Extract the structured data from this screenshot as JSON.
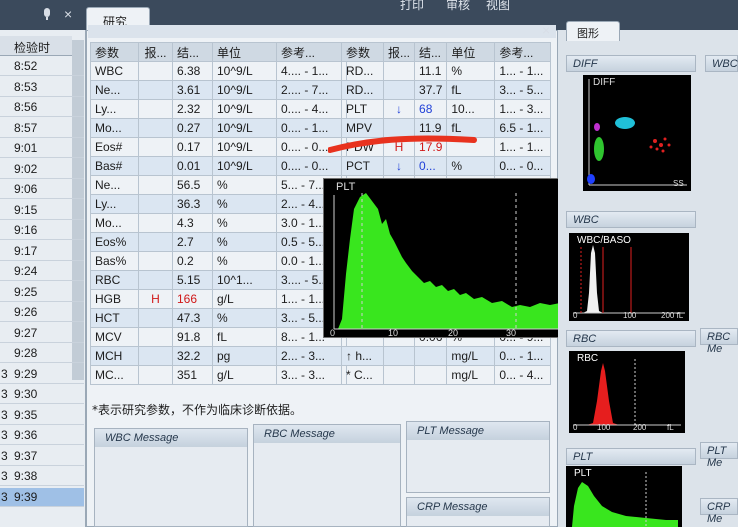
{
  "topbar": {
    "items": [
      "打印",
      "审核",
      "视图"
    ],
    "tab_research": "研究",
    "tab_graphics": "图形",
    "close": "×"
  },
  "left_panel": {
    "header": "检验时",
    "times": [
      "8:52",
      "8:53",
      "8:56",
      "8:57",
      "9:01",
      "9:02",
      "9:06",
      "9:15",
      "9:16",
      "9:17",
      "9:24",
      "9:25",
      "9:26",
      "9:27",
      "9:28",
      "9:29",
      "9:30",
      "9:35",
      "9:36",
      "9:37",
      "9:38",
      "9:39"
    ],
    "prefixes": [
      "",
      "",
      "",
      "",
      "",
      "",
      "",
      "",
      "",
      "",
      "",
      "",
      "",
      "",
      "",
      "3",
      "3",
      "3",
      "3",
      "3",
      "3",
      "3"
    ],
    "selected_index": 21
  },
  "table1": {
    "headers": [
      "参数",
      "报...",
      "结...",
      "单位",
      "参考..."
    ],
    "rows": [
      {
        "name": "WBC",
        "flag": "",
        "result": "6.38",
        "unit": "10^9/L",
        "ref": "4.... - 1..."
      },
      {
        "name": "Ne...",
        "flag": "",
        "result": "3.61",
        "unit": "10^9/L",
        "ref": "2.... - 7..."
      },
      {
        "name": "Ly...",
        "flag": "",
        "result": "2.32",
        "unit": "10^9/L",
        "ref": "0.... - 4..."
      },
      {
        "name": "Mo...",
        "flag": "",
        "result": "0.27",
        "unit": "10^9/L",
        "ref": "0.... - 1..."
      },
      {
        "name": "Eos#",
        "flag": "",
        "result": "0.17",
        "unit": "10^9/L",
        "ref": "0.... - 0..."
      },
      {
        "name": "Bas#",
        "flag": "",
        "result": "0.01",
        "unit": "10^9/L",
        "ref": "0.... - 0..."
      },
      {
        "name": "Ne...",
        "flag": "",
        "result": "56.5",
        "unit": "%",
        "ref": "5... - 7..."
      },
      {
        "name": "Ly...",
        "flag": "",
        "result": "36.3",
        "unit": "%",
        "ref": "2... - 4..."
      },
      {
        "name": "Mo...",
        "flag": "",
        "result": "4.3",
        "unit": "%",
        "ref": "3.0 - 1..."
      },
      {
        "name": "Eos%",
        "flag": "",
        "result": "2.7",
        "unit": "%",
        "ref": "0.5 - 5..."
      },
      {
        "name": "Bas%",
        "flag": "",
        "result": "0.2",
        "unit": "%",
        "ref": "0.0 - 1..."
      },
      {
        "name": "RBC",
        "flag": "",
        "result": "5.15",
        "unit": "10^1...",
        "ref": "3.... - 5..."
      },
      {
        "name": "HGB",
        "flag": "H",
        "result": "166",
        "unit": "g/L",
        "ref": "1... - 1..."
      },
      {
        "name": "HCT",
        "flag": "",
        "result": "47.3",
        "unit": "%",
        "ref": "3... - 5..."
      },
      {
        "name": "MCV",
        "flag": "",
        "result": "91.8",
        "unit": "fL",
        "ref": "8... - 1..."
      },
      {
        "name": "MCH",
        "flag": "",
        "result": "32.2",
        "unit": "pg",
        "ref": "2... - 3..."
      },
      {
        "name": "MC...",
        "flag": "",
        "result": "351",
        "unit": "g/L",
        "ref": "3... - 3..."
      }
    ]
  },
  "table2": {
    "headers": [
      "参数",
      "报...",
      "结...",
      "单位",
      "参考..."
    ],
    "rows": [
      {
        "name": "RD...",
        "flag": "",
        "result": "11.1",
        "unit": "%",
        "ref": "1... - 1..."
      },
      {
        "name": "RD...",
        "flag": "",
        "result": "37.7",
        "unit": "fL",
        "ref": "3... - 5..."
      },
      {
        "name": "PLT",
        "flag": "↓",
        "result": "68",
        "unit": "10...",
        "ref": "1... - 3..."
      },
      {
        "name": "MPV",
        "flag": "",
        "result": "11.9",
        "unit": "fL",
        "ref": "6.5 - 1..."
      },
      {
        "name": "PDW",
        "flag": "H",
        "result": "17.9",
        "unit": "",
        "ref": "1... - 1..."
      },
      {
        "name": "PCT",
        "flag": "↓",
        "result": "0...",
        "unit": "%",
        "ref": "0... - 0..."
      },
      {
        "name": "",
        "flag": "",
        "result": "",
        "unit": "",
        "ref": ""
      },
      {
        "name": "",
        "flag": "",
        "result": "",
        "unit": "",
        "ref": ""
      },
      {
        "name": "",
        "flag": "",
        "result": "",
        "unit": "",
        "ref": ""
      },
      {
        "name": "",
        "flag": "",
        "result": "",
        "unit": "",
        "ref": ""
      },
      {
        "name": "",
        "flag": "",
        "result": "",
        "unit": "",
        "ref": ""
      },
      {
        "name": "",
        "flag": "",
        "result": "",
        "unit": "",
        "ref": ""
      },
      {
        "name": "",
        "flag": "",
        "result": "",
        "unit": "",
        "ref": ""
      },
      {
        "name": "",
        "flag": "",
        "result": "",
        "unit": "",
        "ref": ""
      },
      {
        "name": "",
        "flag": "",
        "result": "0.06",
        "unit": "%",
        "ref": "0... - 9..."
      },
      {
        "name": "↑ h...",
        "flag": "",
        "result": "",
        "unit": "mg/L",
        "ref": "0... - 1..."
      },
      {
        "name": "* C...",
        "flag": "",
        "result": "",
        "unit": "mg/L",
        "ref": "0... - 4..."
      }
    ]
  },
  "note": "*表示研究参数，不作为临床诊断依据。",
  "messages": {
    "wbc": "WBC Message",
    "rbc": "RBC Message",
    "plt": "PLT Message",
    "crp": "CRP Message"
  },
  "plt_popup": {
    "label": "PLT",
    "ticks": [
      "0",
      "10",
      "20",
      "30"
    ]
  },
  "right_panel": {
    "diff_header": "DIFF",
    "diff_label": "DIFF",
    "diff_axis": "SS",
    "wbc_header": "WBC",
    "wbc_basо_label": "WBC/BASO",
    "wbc_ticks": [
      "0",
      "100",
      "200 fL"
    ],
    "rbc_header": "RBC",
    "rbc_label": "RBC",
    "rbc_ticks": [
      "0",
      "100",
      "200",
      "fL"
    ],
    "plt_header": "PLT",
    "plt_label": "PLT",
    "side_labels": [
      "WBC",
      "RBC Me",
      "PLT Me",
      "CRP Me"
    ]
  },
  "colors": {
    "flag_high": "#d01818",
    "flag_low": "#2040d8",
    "histogram": "#39e61e",
    "pen": "#e8321e"
  }
}
